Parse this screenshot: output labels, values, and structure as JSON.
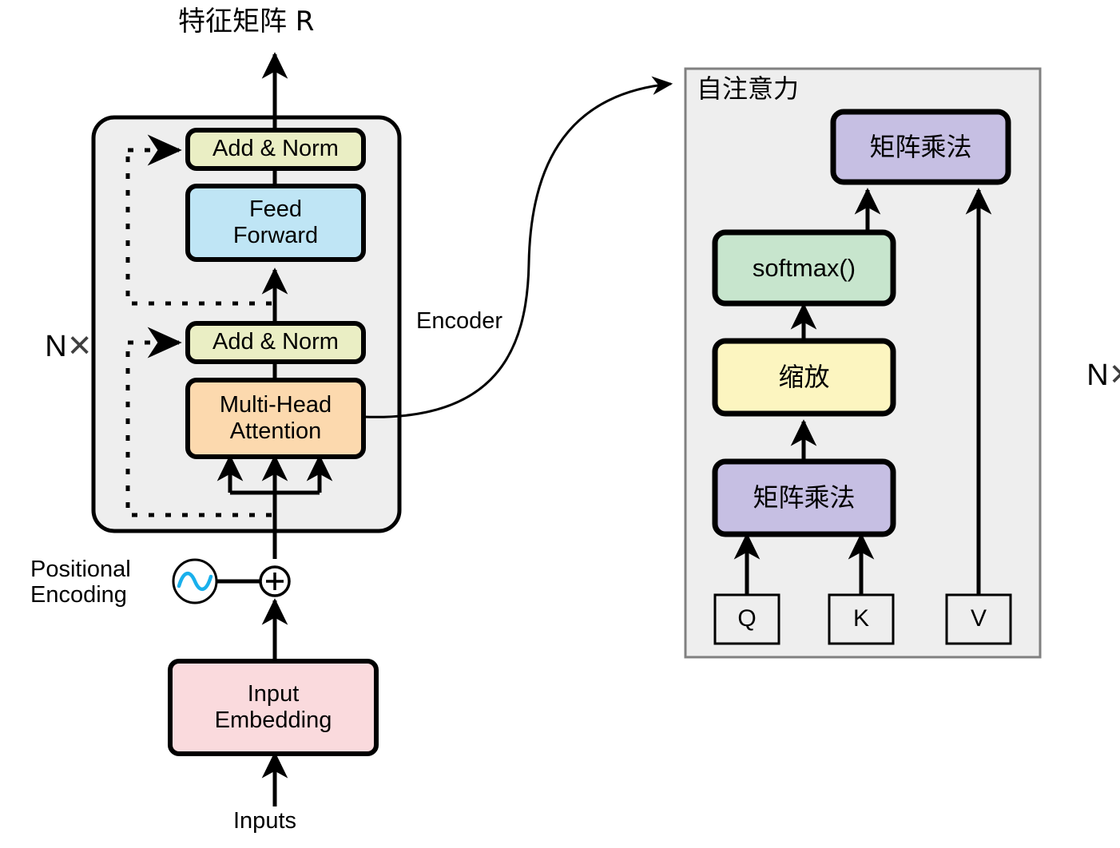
{
  "diagram": {
    "title_output": "特征矩阵 R",
    "encoder_label": "Encoder",
    "positional_encoding_label": "Positional\nEncoding",
    "inputs_label": "Inputs",
    "repeat_left": {
      "n": "N",
      "times": "✕"
    },
    "repeat_right": {
      "n": "N",
      "times": "✕"
    }
  },
  "encoder": {
    "blocks": [
      {
        "id": "add-norm-top",
        "label": "Add & Norm",
        "color": "#eaeec4"
      },
      {
        "id": "feed-forward",
        "label": "Feed\nForward",
        "color": "#bfe5f5"
      },
      {
        "id": "add-norm-bottom",
        "label": "Add & Norm",
        "color": "#eaeec4"
      },
      {
        "id": "multi-head-attention",
        "label": "Multi-Head\nAttention",
        "color": "#fcd9ae"
      },
      {
        "id": "input-embedding",
        "label": "Input\nEmbedding",
        "color": "#fadadd"
      }
    ],
    "panel_fill": "#eeeeee",
    "plus_symbol": "+"
  },
  "self_attention": {
    "panel_title": "自注意力",
    "panel_fill": "#eeeeee",
    "panel_border": "#808080",
    "blocks": [
      {
        "id": "matmul-top",
        "label": "矩阵乘法",
        "color": "#c6bfe3"
      },
      {
        "id": "softmax",
        "label": "softmax()",
        "color": "#c7e5cd"
      },
      {
        "id": "scale",
        "label": "缩放",
        "color": "#fcf5c0"
      },
      {
        "id": "matmul-bottom",
        "label": "矩阵乘法",
        "color": "#c6bfe3"
      }
    ],
    "inputs": [
      {
        "id": "q",
        "label": "Q"
      },
      {
        "id": "k",
        "label": "K"
      },
      {
        "id": "v",
        "label": "V"
      }
    ]
  },
  "colors": {
    "stroke": "#000000",
    "sine_wave": "#19b0ec",
    "panel_gray": "#eeeeee",
    "panel_gray_border": "#808080",
    "nx_glyph": "#3f3f3f"
  }
}
